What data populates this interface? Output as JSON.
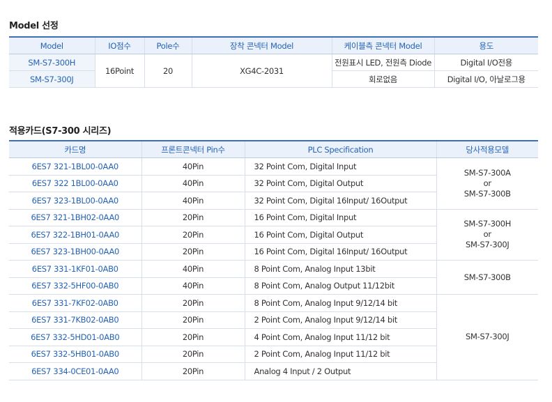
{
  "section1": {
    "title": "Model 선정",
    "headers": [
      "Model",
      "IO점수",
      "Pole수",
      "장착 콘넥터 Model",
      "케이블측 콘넥터 Model",
      "용도"
    ],
    "models": [
      "SM-S7-300H",
      "SM-S7-300J"
    ],
    "io_points": "16Point",
    "pole_count": "20",
    "mount_connector": "XG4C-2031",
    "cable_connector": [
      "전원표시 LED, 전원측 Diode",
      "회로없음"
    ],
    "usage": [
      "Digital I/O전용",
      "Digital I/O, 아날로그용"
    ]
  },
  "section2": {
    "title": "적용카드(S7-300 시리즈)",
    "headers": [
      "카드명",
      "프론트콘넥터 Pin수",
      "PLC Specification",
      "당사적용모델"
    ],
    "rows": [
      {
        "card": "6ES7 321-1BL00-0AA0",
        "pins": "40Pin",
        "spec": "32 Point Com, Digital Input"
      },
      {
        "card": "6ES7 322 1BL00-0AA0",
        "pins": "40Pin",
        "spec": "32 Point Com, Digital Output"
      },
      {
        "card": "6ES7 323-1BL00-0AA0",
        "pins": "40Pin",
        "spec": "32 Point Com, Digital 16Input/ 16Output"
      },
      {
        "card": "6ES7 321-1BH02-0AA0",
        "pins": "20Pin",
        "spec": "16 Point Com, Digital Input"
      },
      {
        "card": "6ES7 322-1BH01-0AA0",
        "pins": "20Pin",
        "spec": "16 Point Com, Digital Output"
      },
      {
        "card": "6ES7 323-1BH00-0AA0",
        "pins": "20Pin",
        "spec": "16 Point Com, Digital 16Input/ 16Output"
      },
      {
        "card": "6ES7 331-1KF01-0AB0",
        "pins": "40Pin",
        "spec": "8 Point Com, Analog Input 13bit"
      },
      {
        "card": "6ES7 332-5HF00-0AB0",
        "pins": "40Pin",
        "spec": "8 Point Com, Analog Output 11/12bit"
      },
      {
        "card": "6ES7 331-7KF02-0AB0",
        "pins": "20Pin",
        "spec": "8 Point Com, Analog Input 9/12/14 bit"
      },
      {
        "card": "6ES7 331-7KB02-0AB0",
        "pins": "20Pin",
        "spec": "2 Point Com, Analog Input 9/12/14 bit"
      },
      {
        "card": "6ES7 332-5HD01-0AB0",
        "pins": "20Pin",
        "spec": "4 Point Com, Analog Input 11/12 bit"
      },
      {
        "card": "6ES7 332-5HB01-0AB0",
        "pins": "20Pin",
        "spec": "2 Point Com, Analog Input 11/12 bit"
      },
      {
        "card": "6ES7 334-0CE01-0AA0",
        "pins": "20Pin",
        "spec": "Analog 4 Input / 2 Output"
      }
    ],
    "groups": [
      {
        "line1": "SM-S7-300A",
        "line2": "or",
        "line3": "SM-S7-300B"
      },
      {
        "line1": "SM-S7-300H",
        "line2": "or",
        "line3": "SM-S7-300J"
      },
      {
        "line1": "SM-S7-300B"
      },
      {
        "line1": "SM-S7-300J"
      }
    ]
  }
}
